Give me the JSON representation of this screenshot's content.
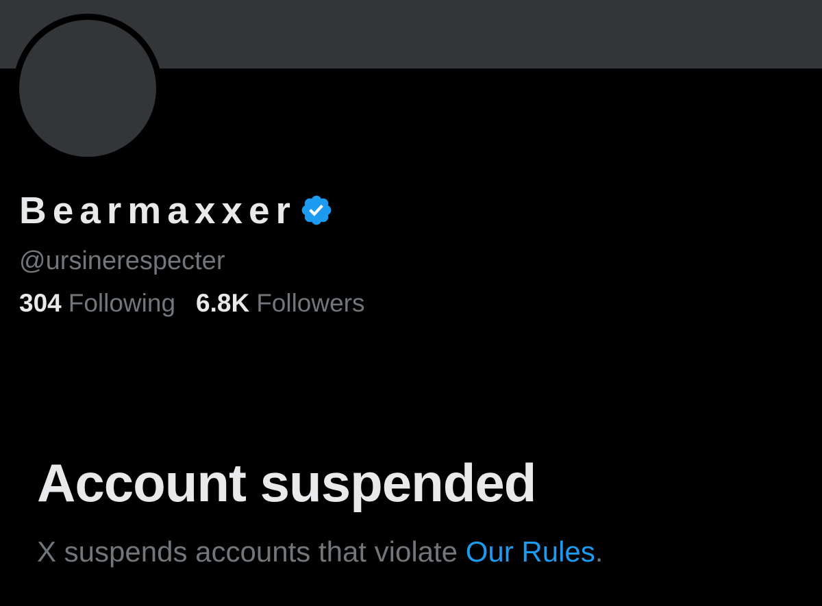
{
  "profile": {
    "display_name": "Bearmaxxer",
    "handle": "@ursinerespecter",
    "verified_icon": "verified-badge-icon",
    "following_count": "304",
    "following_label": "Following",
    "followers_count": "6.8K",
    "followers_label": "Followers"
  },
  "suspension": {
    "title": "Account suspended",
    "description_prefix": "X suspends accounts that violate ",
    "rules_link": "Our Rules",
    "description_suffix": "."
  },
  "colors": {
    "background": "#000000",
    "banner": "#333639",
    "primary_text": "#e7e9ea",
    "secondary_text": "#71767b",
    "accent": "#1d9bf0"
  }
}
